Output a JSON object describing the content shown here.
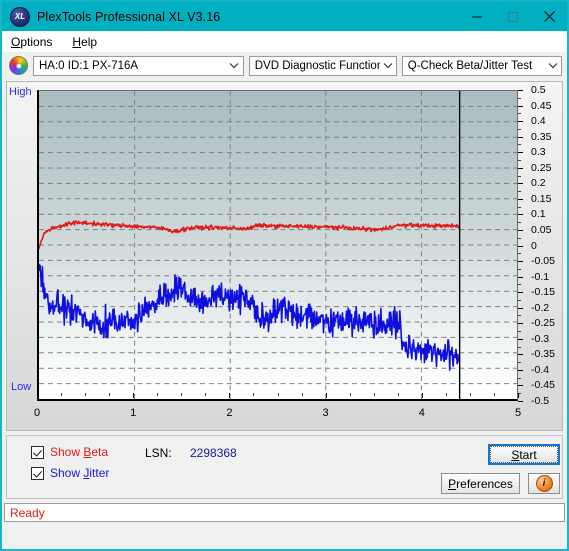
{
  "window": {
    "title": "PlexTools Professional XL V3.16",
    "icon": "XL",
    "icon_name": "plextools-logo-icon",
    "minimize": "minimize-icon",
    "maximize": "maximize-icon",
    "close": "close-icon",
    "titlebar_color": "#00b0c0"
  },
  "menu": {
    "items": [
      {
        "label": "Options",
        "mnemonic": "O"
      },
      {
        "label": "Help",
        "mnemonic": "H"
      }
    ]
  },
  "toolbar": {
    "drive_icon": "disc-icon",
    "drive": "HA:0 ID:1  PX-716A",
    "function": "DVD Diagnostic Functions",
    "test": "Q-Check Beta/Jitter Test",
    "arrow": "chevron-down-icon"
  },
  "controls": {
    "show_beta": "Show Beta",
    "show_beta_pre": "Show ",
    "show_beta_mn": "B",
    "show_beta_post": "eta",
    "show_beta_checked": true,
    "show_jitter_pre": "Show ",
    "show_jitter_mn": "J",
    "show_jitter_post": "itter",
    "show_jitter_checked": true,
    "lsn_label": "LSN:",
    "lsn_value": "2298368",
    "start_pre": "",
    "start_mn": "S",
    "start_post": "tart",
    "preferences_pre": "",
    "preferences_mn": "P",
    "preferences_post": "references",
    "info_icon": "info-icon",
    "info_glyph": "i"
  },
  "status": {
    "text": "Ready",
    "color": "#e01b1b"
  },
  "chart_data": {
    "type": "line",
    "title": "Q-Check Beta/Jitter Test",
    "xlabel": "",
    "ylabel": "",
    "axis_high_label": "High",
    "axis_low_label": "Low",
    "xlim": [
      0,
      5
    ],
    "ylim": [
      -0.5,
      0.5
    ],
    "x_ticks": [
      0,
      1,
      2,
      3,
      4,
      5
    ],
    "x_minor_step": 0.25,
    "y_ticks": [
      0.5,
      0.45,
      0.4,
      0.35,
      0.3,
      0.25,
      0.2,
      0.15,
      0.1,
      0.05,
      0,
      -0.05,
      -0.1,
      -0.15,
      -0.2,
      -0.25,
      -0.3,
      -0.35,
      -0.4,
      -0.45,
      -0.5
    ],
    "grid": true,
    "grid_style": "dashed",
    "grid_color": "#808080",
    "plot_bg_gradient": [
      "#a9bcc0",
      "#ffffff"
    ],
    "cursor_x": 4.4,
    "cursor_color": "#000000",
    "data_end_x": 4.4,
    "legend_position": "external-checkboxes",
    "series": [
      {
        "name": "Beta",
        "color": "#e01b1b",
        "x": [
          0.0,
          0.03,
          0.06,
          0.09,
          0.12,
          0.16,
          0.2,
          0.25,
          0.3,
          0.36,
          0.42,
          0.48,
          0.55,
          0.62,
          0.7,
          0.78,
          0.86,
          0.95,
          1.05,
          1.15,
          1.25,
          1.35,
          1.42,
          1.48,
          1.55,
          1.62,
          1.7,
          1.8,
          1.9,
          2.0,
          2.1,
          2.2,
          2.26,
          2.32,
          2.45,
          2.6,
          2.75,
          2.9,
          3.05,
          3.2,
          3.35,
          3.45,
          3.55,
          3.62,
          3.7,
          3.8,
          3.9,
          4.0,
          4.1,
          4.2,
          4.3,
          4.4
        ],
        "y": [
          -0.01,
          0.02,
          0.04,
          0.048,
          0.052,
          0.056,
          0.06,
          0.064,
          0.068,
          0.071,
          0.073,
          0.072,
          0.07,
          0.068,
          0.066,
          0.064,
          0.063,
          0.062,
          0.06,
          0.058,
          0.055,
          0.05,
          0.044,
          0.048,
          0.054,
          0.056,
          0.057,
          0.057,
          0.056,
          0.055,
          0.054,
          0.053,
          0.062,
          0.063,
          0.062,
          0.061,
          0.06,
          0.059,
          0.058,
          0.056,
          0.053,
          0.051,
          0.05,
          0.052,
          0.062,
          0.064,
          0.064,
          0.063,
          0.063,
          0.062,
          0.062,
          0.061
        ]
      },
      {
        "name": "Jitter",
        "color": "#0f0fe0",
        "x": [
          0.0,
          0.02,
          0.05,
          0.08,
          0.12,
          0.18,
          0.25,
          0.32,
          0.4,
          0.48,
          0.56,
          0.64,
          0.72,
          0.8,
          0.88,
          0.96,
          1.04,
          1.12,
          1.2,
          1.28,
          1.36,
          1.42,
          1.48,
          1.54,
          1.6,
          1.68,
          1.76,
          1.84,
          1.92,
          2.0,
          2.08,
          2.16,
          2.24,
          2.26,
          2.34,
          2.42,
          2.5,
          2.58,
          2.66,
          2.74,
          2.82,
          2.9,
          2.98,
          3.06,
          3.14,
          3.22,
          3.3,
          3.38,
          3.46,
          3.54,
          3.62,
          3.7,
          3.78,
          3.8,
          3.88,
          3.96,
          4.04,
          4.12,
          4.2,
          4.28,
          4.36,
          4.4
        ],
        "y": [
          -0.06,
          -0.1,
          -0.13,
          -0.16,
          -0.19,
          -0.2,
          -0.21,
          -0.22,
          -0.23,
          -0.24,
          -0.25,
          -0.26,
          -0.25,
          -0.24,
          -0.24,
          -0.25,
          -0.24,
          -0.21,
          -0.19,
          -0.18,
          -0.17,
          -0.15,
          -0.13,
          -0.16,
          -0.18,
          -0.19,
          -0.18,
          -0.17,
          -0.16,
          -0.17,
          -0.17,
          -0.17,
          -0.18,
          -0.22,
          -0.23,
          -0.23,
          -0.21,
          -0.2,
          -0.22,
          -0.23,
          -0.23,
          -0.24,
          -0.24,
          -0.25,
          -0.25,
          -0.25,
          -0.24,
          -0.24,
          -0.25,
          -0.25,
          -0.25,
          -0.25,
          -0.26,
          -0.32,
          -0.33,
          -0.34,
          -0.34,
          -0.35,
          -0.35,
          -0.36,
          -0.36,
          -0.37
        ]
      }
    ],
    "noise_band": {
      "Beta": 0.004,
      "Jitter": 0.028
    }
  }
}
